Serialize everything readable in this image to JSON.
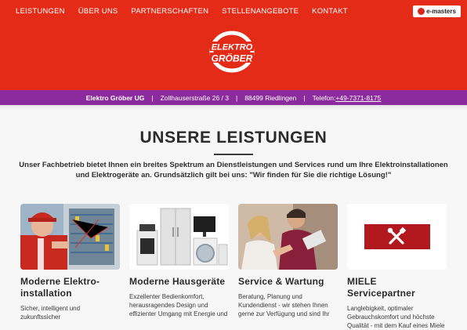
{
  "nav": {
    "items": [
      "LEISTUNGEN",
      "ÜBER UNS",
      "PARTNERSCHAFTEN",
      "STELLENANGEBOTE",
      "KONTAKT"
    ]
  },
  "badge": {
    "label": "e-masters"
  },
  "logo": {
    "line1": "ELEKTRO",
    "line2": "GRÖBER"
  },
  "infobar": {
    "company": "Elektro Gröber UG",
    "street": "Zollhauserstraße 26 / 3",
    "city": "88499 Riedlingen",
    "tel_label": "Telefon:",
    "tel_number": "+49-7371-8175"
  },
  "section": {
    "title": "UNSERE LEISTUNGEN",
    "intro": "Unser Fachbetrieb bietet Ihnen ein breites Spektrum an Dienstleistungen und Services rund um Ihre Elektroinstallationen und Elektrogeräte an. Grundsätzlich gilt bei uns: \"Wir finden für Sie die richtige Lösung!\""
  },
  "cards": [
    {
      "title": "Moderne Elektro-installation",
      "text": "Sicher, intelligent und zukunftssicher"
    },
    {
      "title": "Moderne Hausgeräte",
      "text": "Exzellenter Bedienkomfort, herausragendes Design und effizienter Umgang mit Energie und"
    },
    {
      "title": "Service & Wartung",
      "text": "Beratung, Planung und Kundendienst - wir stehen Ihnen gerne zur Verfügung und sind Ihr"
    },
    {
      "title": "MIELE Servicepartner",
      "text": "Langlebigkeit, optimaler Gebrauchskomfort und höchste Qualität - mit dem Kauf eines Miele"
    }
  ],
  "colors": {
    "header": "#e32b17",
    "infobar": "#8c2b9e",
    "miele": "#b3181f"
  }
}
